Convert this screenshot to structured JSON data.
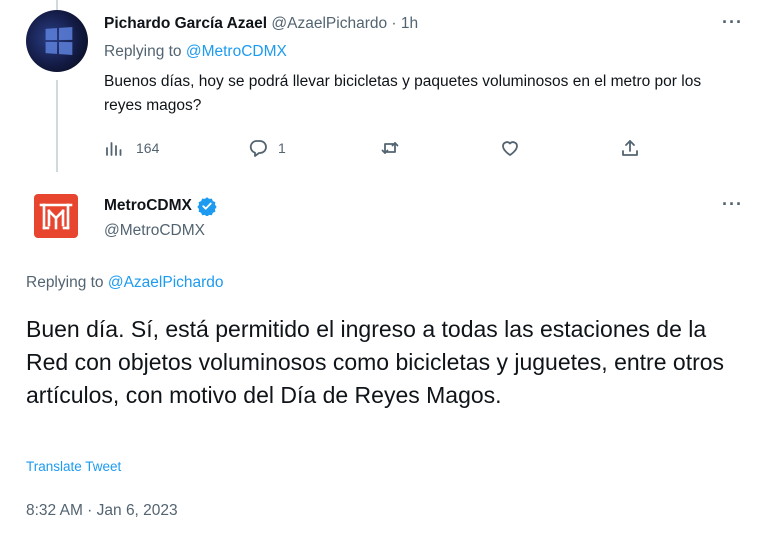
{
  "tweet1": {
    "author_name": "Pichardo García Azael",
    "handle_time": " @AzaelPichardo · 1h",
    "replying_prefix": "Replying to ",
    "replying_to": "@MetroCDMX",
    "text": "Buenos días, hoy se podrá llevar bicicletas y paquetes voluminosos en el metro por los reyes magos?",
    "views": "164",
    "replies": "1"
  },
  "tweet2": {
    "author_name": "MetroCDMX",
    "handle": "@MetroCDMX",
    "replying_prefix": "Replying to ",
    "replying_to": "@AzaelPichardo",
    "text": "Buen día. Sí, está permitido el ingreso a todas las estaciones de la Red con objetos voluminosos como bicicletas y juguetes, entre otros artículos, con motivo del Día de Reyes Magos.",
    "translate": "Translate Tweet",
    "timestamp": "8:32 AM · Jan 6, 2023"
  },
  "icons": {
    "more": "···",
    "views": "views-icon",
    "reply": "reply-icon",
    "retweet": "retweet-icon",
    "like": "like-icon",
    "share": "share-icon",
    "verified": "verified-badge-icon"
  },
  "colors": {
    "accent": "#1d9bf0",
    "muted": "#536471",
    "text": "#0f1419",
    "metro_logo": "#e8452f"
  }
}
